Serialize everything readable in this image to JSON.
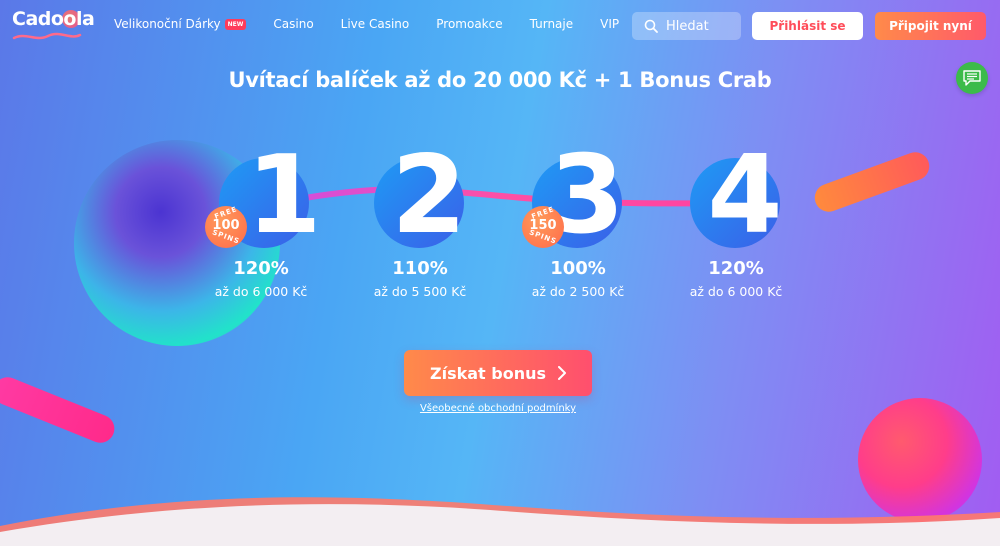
{
  "header": {
    "logo_text": "Cadoola",
    "nav": [
      {
        "label": "Velikonoční Dárky",
        "badge": "NEW"
      },
      {
        "label": "Casino"
      },
      {
        "label": "Live Casino"
      },
      {
        "label": "Promoakce"
      },
      {
        "label": "Turnaje"
      },
      {
        "label": "VIP"
      }
    ],
    "search_label": "Hledat",
    "login_label": "Přihlásit se",
    "join_label": "Připojit nyní"
  },
  "headline": "Uvítací balíček až do 20 000 Kč + 1 Bonus Crab",
  "steps": [
    {
      "number": "1",
      "percent": "120%",
      "sub": "až do 6 000 Kč",
      "badge": {
        "top": "FREE",
        "num": "100",
        "bottom": "SPINS"
      }
    },
    {
      "number": "2",
      "percent": "110%",
      "sub": "až do 5 500 Kč"
    },
    {
      "number": "3",
      "percent": "100%",
      "sub": "až do 2 500 Kč",
      "badge": {
        "top": "FREE",
        "num": "150",
        "bottom": "SPINS"
      }
    },
    {
      "number": "4",
      "percent": "120%",
      "sub": "až do 6 000 Kč"
    }
  ],
  "cta_label": "Získat bonus",
  "terms_label": "Všeobecné obchodní podmínky",
  "colors": {
    "accent_orange": "#ff8a4a",
    "accent_pink": "#ff4f6e",
    "chat_green": "#3cbb4a"
  },
  "icons": {
    "search": "search-icon",
    "chat": "chat-icon",
    "cta_arrow": "chevron-right-icon"
  }
}
